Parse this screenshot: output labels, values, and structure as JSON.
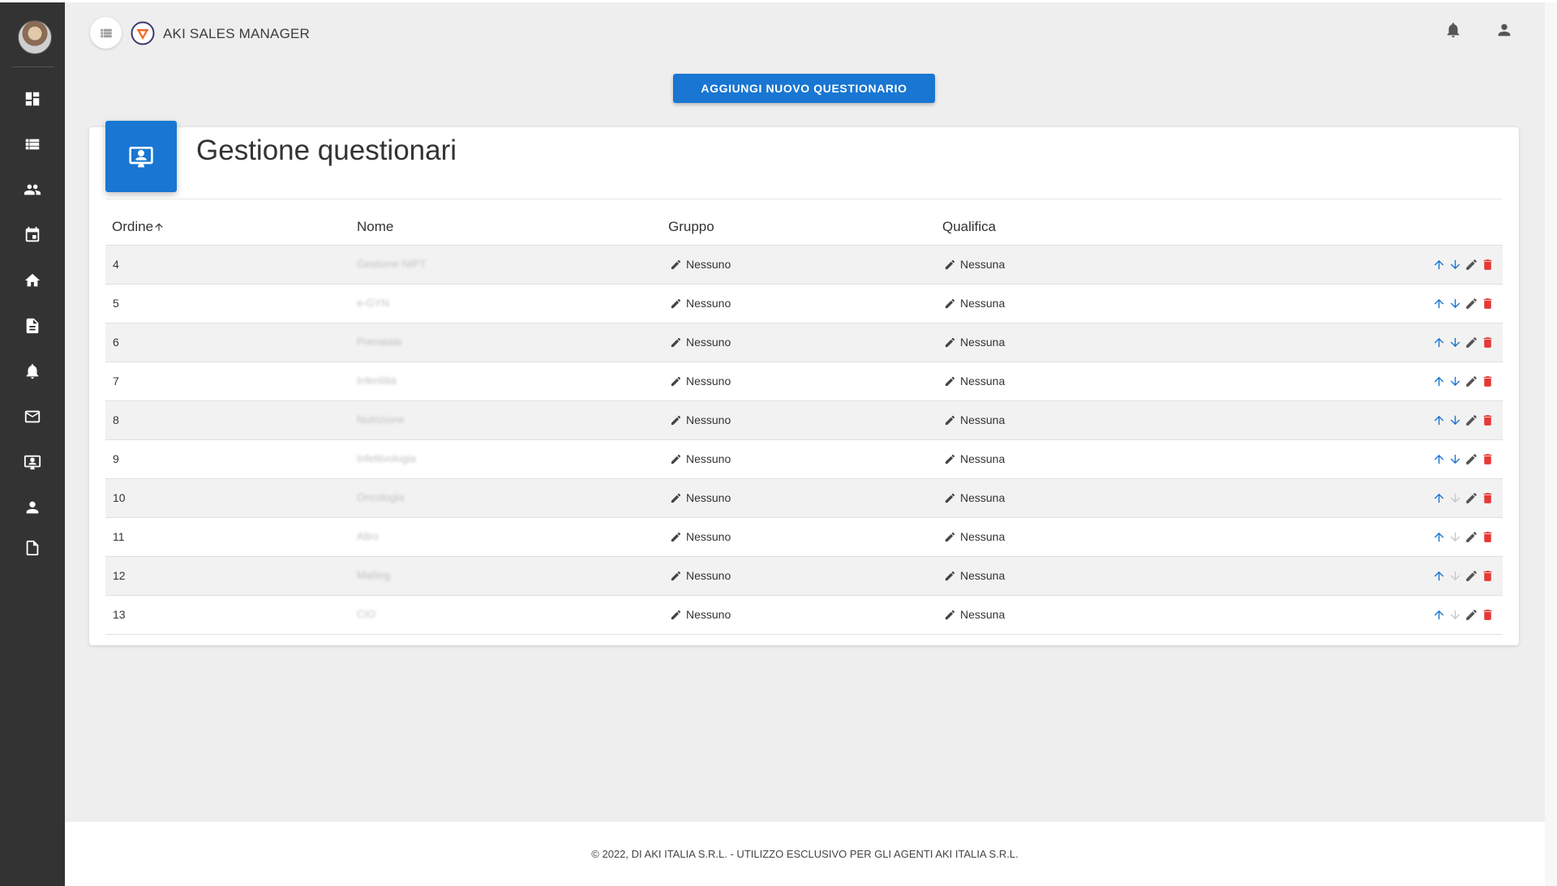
{
  "app": {
    "title": "AKI SALES MANAGER"
  },
  "sidebar": {
    "items": [
      {
        "icon": "dashboard-icon"
      },
      {
        "icon": "list-icon"
      },
      {
        "icon": "people-icon"
      },
      {
        "icon": "calendar-icon"
      },
      {
        "icon": "home-icon"
      },
      {
        "icon": "document-icon"
      },
      {
        "icon": "bell-icon"
      },
      {
        "icon": "mail-icon"
      },
      {
        "icon": "questionnaire-icon"
      },
      {
        "icon": "person-icon"
      },
      {
        "icon": "file-icon"
      }
    ]
  },
  "toolbar": {
    "add_label": "AGGIUNGI NUOVO QUESTIONARIO"
  },
  "card": {
    "title": "Gestione questionari",
    "accent": "#1976d2"
  },
  "table": {
    "headers": {
      "ordine": "Ordine",
      "nome": "Nome",
      "gruppo": "Gruppo",
      "qualifica": "Qualifica"
    },
    "rows": [
      {
        "ordine": "4",
        "nome": "Gestione NIPT",
        "gruppo": "Nessuno",
        "qualifica": "Nessuna",
        "down_enabled": true
      },
      {
        "ordine": "5",
        "nome": "e-GYN",
        "gruppo": "Nessuno",
        "qualifica": "Nessuna",
        "down_enabled": true
      },
      {
        "ordine": "6",
        "nome": "Prenatale",
        "gruppo": "Nessuno",
        "qualifica": "Nessuna",
        "down_enabled": true
      },
      {
        "ordine": "7",
        "nome": "Infertilità",
        "gruppo": "Nessuno",
        "qualifica": "Nessuna",
        "down_enabled": true
      },
      {
        "ordine": "8",
        "nome": "Nutrizione",
        "gruppo": "Nessuno",
        "qualifica": "Nessuna",
        "down_enabled": true
      },
      {
        "ordine": "9",
        "nome": "Infettivologia",
        "gruppo": "Nessuno",
        "qualifica": "Nessuna",
        "down_enabled": true
      },
      {
        "ordine": "10",
        "nome": "Oncologia",
        "gruppo": "Nessuno",
        "qualifica": "Nessuna",
        "down_enabled": false
      },
      {
        "ordine": "11",
        "nome": "Altro",
        "gruppo": "Nessuno",
        "qualifica": "Nessuna",
        "down_enabled": false
      },
      {
        "ordine": "12",
        "nome": "Mailing",
        "gruppo": "Nessuno",
        "qualifica": "Nessuna",
        "down_enabled": false
      },
      {
        "ordine": "13",
        "nome": "CIO",
        "gruppo": "Nessuno",
        "qualifica": "Nessuna",
        "down_enabled": false
      }
    ]
  },
  "footer": {
    "text": "© 2022, DI AKI ITALIA S.R.L. - UTILIZZO ESCLUSIVO PER GLI AGENTI AKI ITALIA S.R.L."
  },
  "colors": {
    "primary": "#1976d2",
    "delete": "#e53935",
    "sidebar": "#333333"
  }
}
